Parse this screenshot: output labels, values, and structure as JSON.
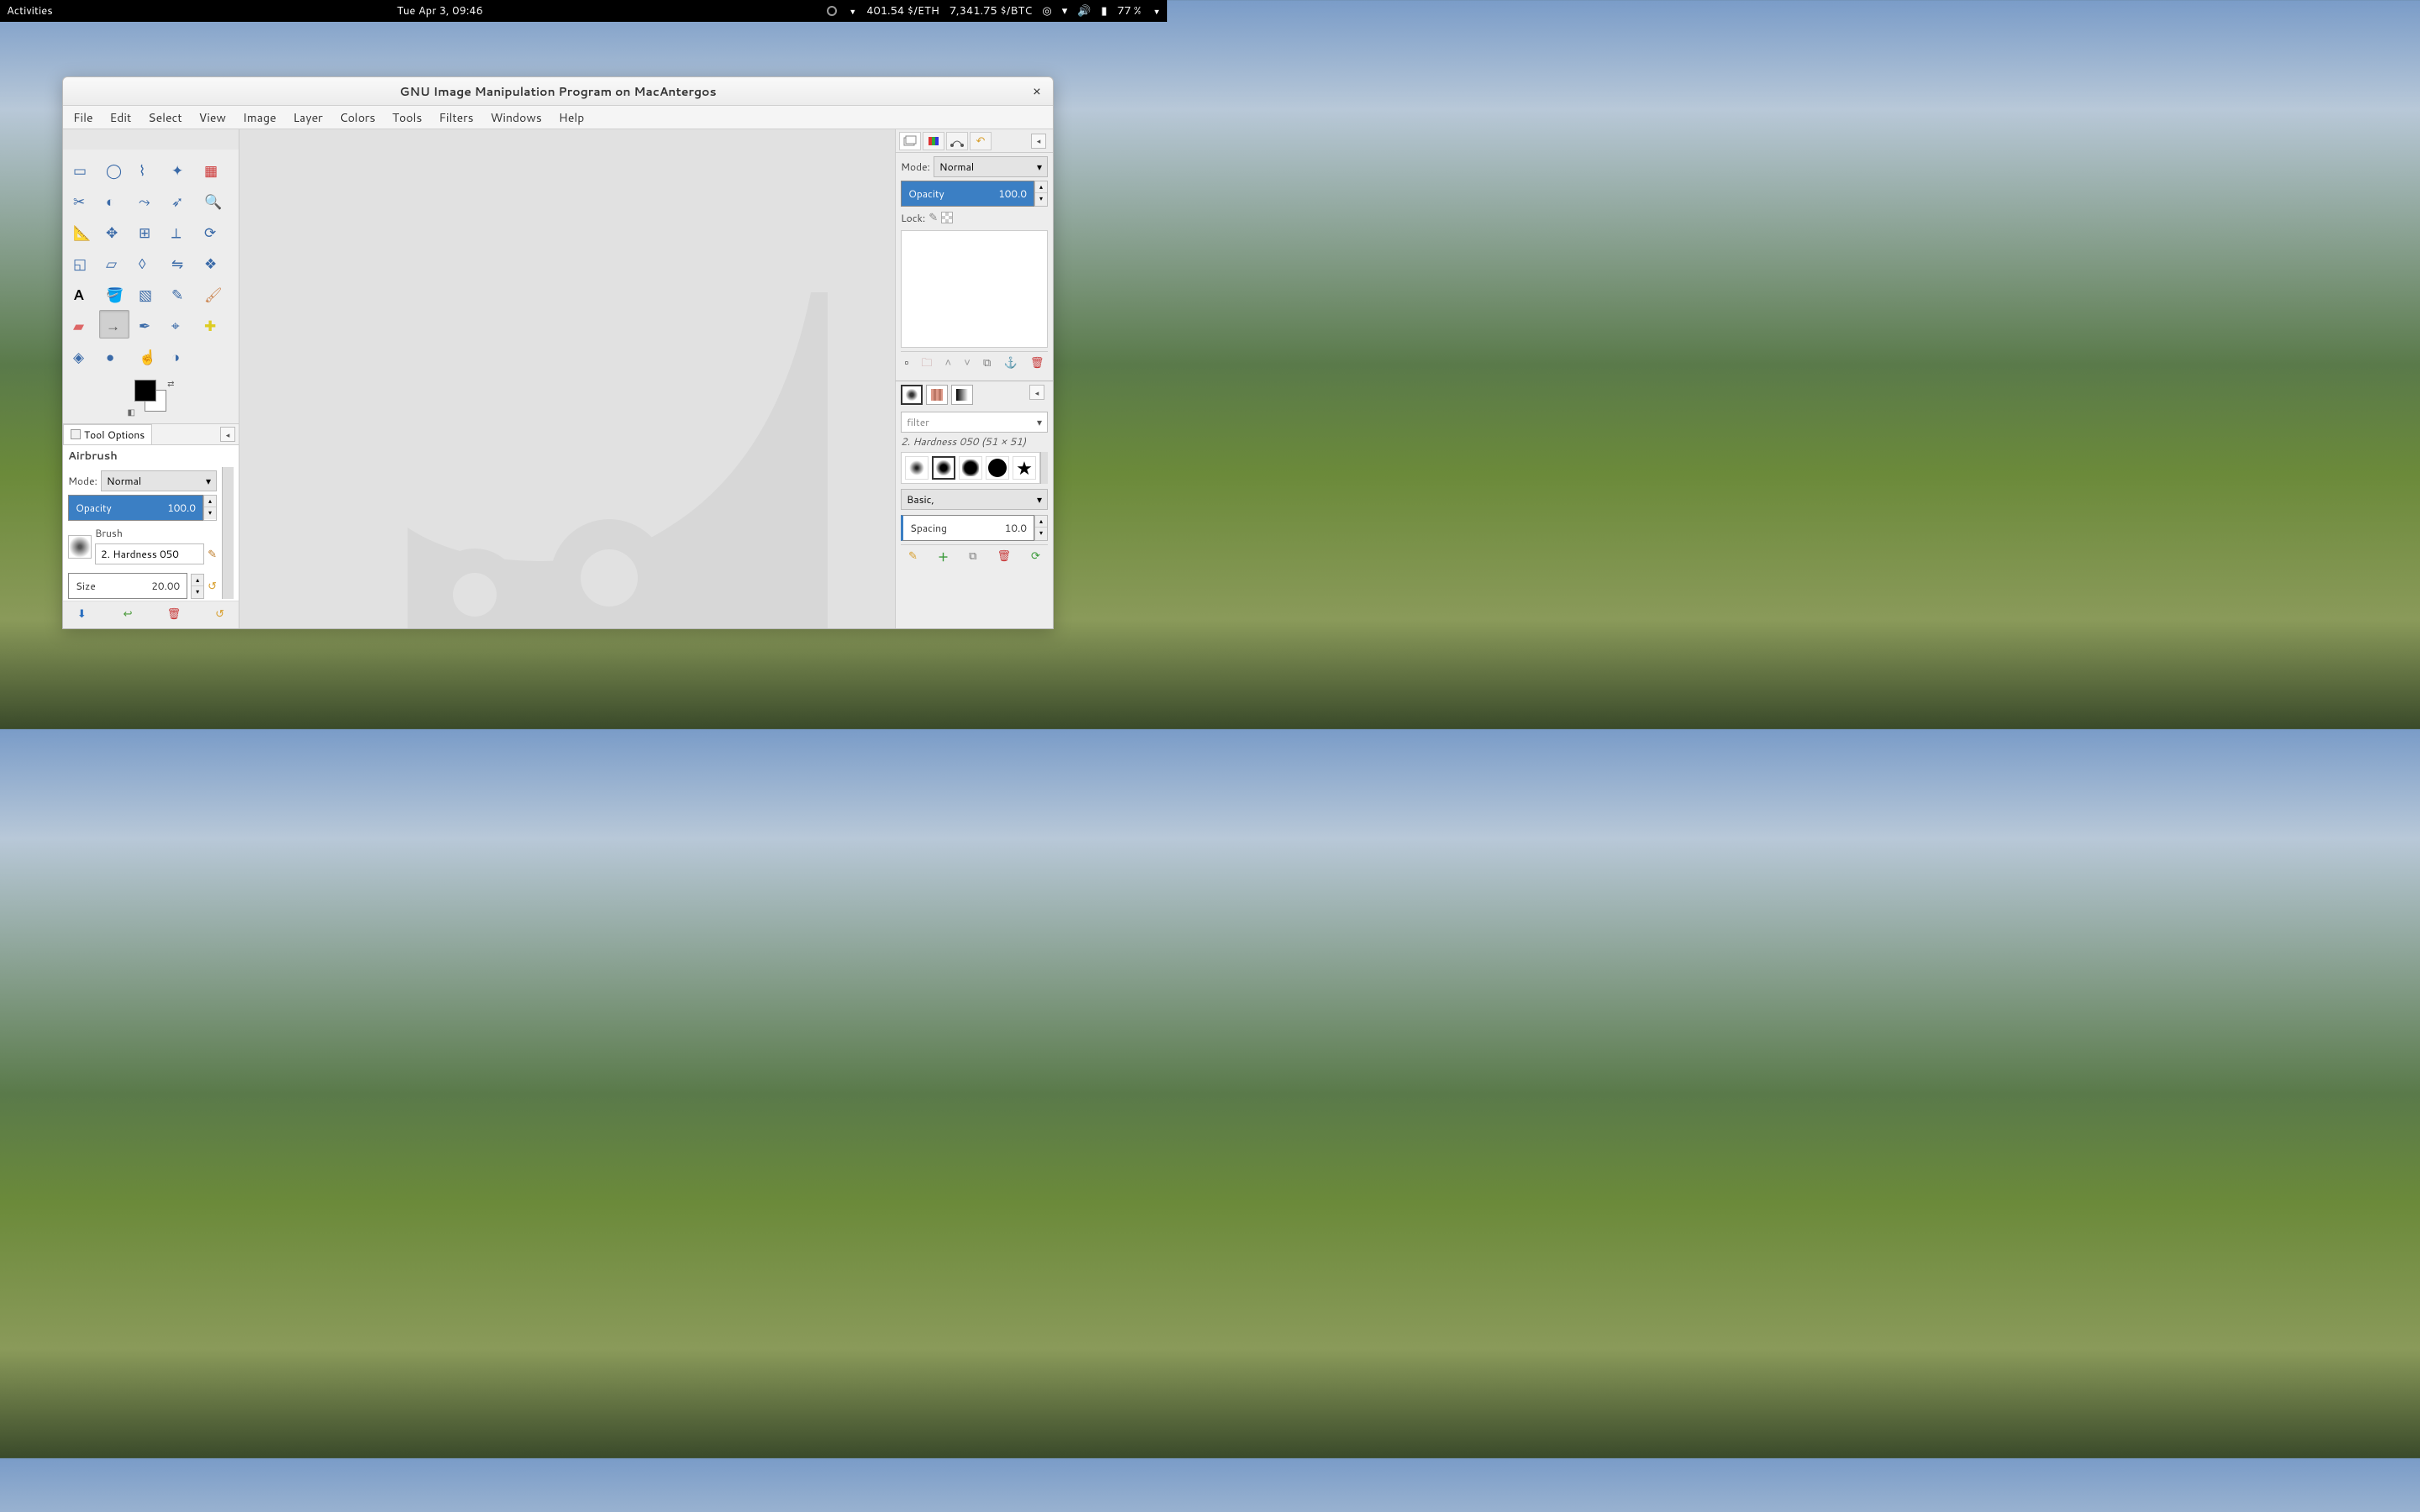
{
  "topbar": {
    "activities": "Activities",
    "datetime": "Tue Apr  3, 09:46",
    "eth": "401.54 $/ETH",
    "btc": "7,341.75 $/BTC",
    "battery": "77 %"
  },
  "window": {
    "title": "GNU Image Manipulation Program on MacAntergos",
    "menu": [
      "File",
      "Edit",
      "Select",
      "View",
      "Image",
      "Layer",
      "Colors",
      "Tools",
      "Filters",
      "Windows",
      "Help"
    ]
  },
  "toolbox": {
    "tools": [
      "rect-select",
      "ellipse-select",
      "free-select",
      "fuzzy-select",
      "by-color-select",
      "scissors",
      "foreground-select",
      "paths",
      "color-picker",
      "zoom",
      "measure",
      "move",
      "align",
      "crop",
      "rotate",
      "scale",
      "shear",
      "perspective",
      "flip",
      "cage",
      "text",
      "bucket-fill",
      "blend",
      "pencil",
      "paintbrush",
      "eraser",
      "airbrush",
      "ink",
      "clone",
      "heal",
      "perspective-clone",
      "blur-sharpen",
      "smudge",
      "dodge-burn"
    ],
    "active_tool_index": 26
  },
  "tool_options": {
    "panel_label": "Tool Options",
    "tool_label": "Airbrush",
    "mode_label": "Mode:",
    "mode_value": "Normal",
    "opacity_label": "Opacity",
    "opacity_value": "100.0",
    "brush_label": "Brush",
    "brush_name": "2. Hardness 050",
    "size_label": "Size",
    "size_value": "20.00"
  },
  "layers": {
    "mode_label": "Mode:",
    "mode_value": "Normal",
    "opacity_label": "Opacity",
    "opacity_value": "100.0",
    "lock_label": "Lock:"
  },
  "brushes": {
    "filter_placeholder": "filter",
    "current": "2. Hardness 050 (51 × 51)",
    "category": "Basic,",
    "spacing_label": "Spacing",
    "spacing_value": "10.0"
  }
}
